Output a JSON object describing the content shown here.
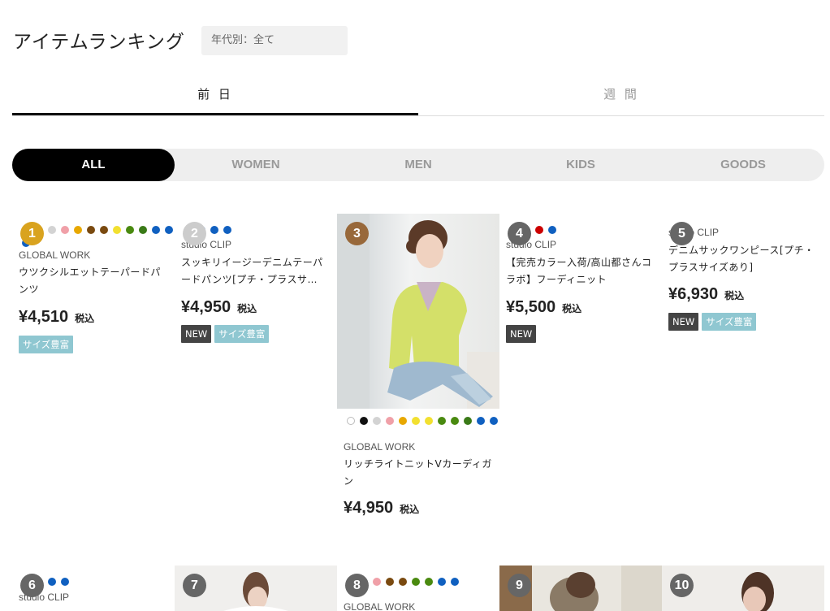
{
  "header": {
    "title": "アイテムランキング",
    "age_filter": "年代別：全て"
  },
  "period_tabs": [
    {
      "label": "前 日",
      "active": true
    },
    {
      "label": "週 間",
      "active": false
    }
  ],
  "categories": [
    {
      "label": "ALL",
      "active": true
    },
    {
      "label": "WOMEN",
      "active": false
    },
    {
      "label": "MEN",
      "active": false
    },
    {
      "label": "KIDS",
      "active": false
    },
    {
      "label": "GOODS",
      "active": false
    }
  ],
  "tax_label": "税込",
  "tag_labels": {
    "new": "NEW",
    "size": "サイズ豊富"
  },
  "rank_colors": {
    "gold": "#d9a31f",
    "silver": "#cccccc",
    "bronze": "#98683a",
    "other": "#666666"
  },
  "products": [
    {
      "rank": "1",
      "brand": "GLOBAL WORK",
      "name": "ウツクシルエットテーパードパンツ",
      "price": "¥4,510",
      "colors": [
        "#1a5fb4",
        "#d3d3d3",
        "#d3d3d3",
        "#f0a0a8",
        "#e8a800",
        "#7a4a10",
        "#7a4a10",
        "#f2e030",
        "#4a8a10",
        "#3a7a18",
        "#1060c0",
        "#1060c0",
        "#1060c0"
      ],
      "tags": [
        "size"
      ]
    },
    {
      "rank": "2",
      "brand": "studio CLIP",
      "name": "スッキリイージーデニムテーパードパンツ[プチ・プラスサ…",
      "price": "¥4,950",
      "colors": [
        "#1060c0",
        "#1060c0",
        "#1060c0",
        "#1060c0"
      ],
      "tags": [
        "new",
        "size"
      ]
    },
    {
      "rank": "3",
      "brand": "GLOBAL WORK",
      "name": "リッチライトニットVカーディガン",
      "price": "¥4,950",
      "colors": [
        "#ffffff",
        "#111111",
        "#d3d3d3",
        "#f0a0a8",
        "#e8a800",
        "#f2e030",
        "#f2e030",
        "#4a8a10",
        "#4a8a10",
        "#3a7a18",
        "#1060c0",
        "#1060c0"
      ],
      "tags": []
    },
    {
      "rank": "4",
      "brand": "studio CLIP",
      "name": "【完売カラー入荷/高山都さんコラボ】フーディニット",
      "price": "¥5,500",
      "colors": [
        "#d3d3d3",
        "#d3d3d3",
        "#cc0000",
        "#1060c0"
      ],
      "tags": [
        "new"
      ]
    },
    {
      "rank": "5",
      "brand": "studio CLIP",
      "name": "デニムサックワンピース[プチ・プラスサイズあり]",
      "price": "¥6,930",
      "colors": [],
      "tags": [
        "new",
        "size"
      ]
    },
    {
      "rank": "6",
      "brand": "studio CLIP",
      "colors": [
        "#d3d3d3",
        "#d3d3d3",
        "#1060c0",
        "#1060c0"
      ]
    },
    {
      "rank": "7"
    },
    {
      "rank": "8",
      "brand": "GLOBAL WORK",
      "colors": [
        "#7a1a9a",
        "#d3d3d3",
        "#f0a0a8",
        "#7a4a10",
        "#7a4a10",
        "#4a8a10",
        "#4a8a10",
        "#1060c0",
        "#1060c0"
      ]
    },
    {
      "rank": "9"
    },
    {
      "rank": "10"
    }
  ]
}
